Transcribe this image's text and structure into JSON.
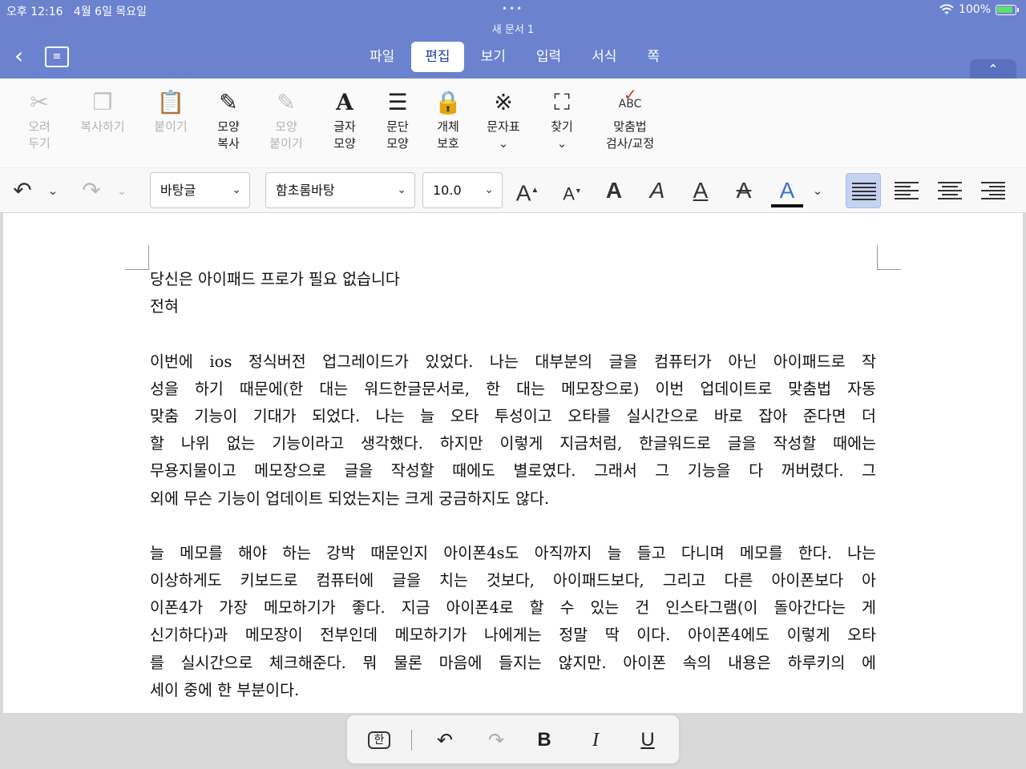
{
  "status_bar": {
    "time": "오후 12:16",
    "date": "4월 6일 목요일",
    "battery": "100%",
    "wifi_icon": "wifi-icon"
  },
  "document": {
    "title": "새 문서 1"
  },
  "menu": {
    "tabs": [
      {
        "label": "파일",
        "active": false
      },
      {
        "label": "편집",
        "active": true
      },
      {
        "label": "보기",
        "active": false
      },
      {
        "label": "입력",
        "active": false
      },
      {
        "label": "서식",
        "active": false
      },
      {
        "label": "쪽",
        "active": false
      }
    ]
  },
  "ribbon": {
    "cut": "오려\n두기",
    "copy": "복사하기",
    "paste": "붙이기",
    "format_copy": "모양\n복사",
    "format_paste": "모양\n붙이기",
    "char_shape": "글자\n모양",
    "para_shape": "문단\n모양",
    "object_protect": "개체\n보호",
    "char_map": "문자표",
    "find": "찾기",
    "spell_check": "맞춤법\n검사/교정",
    "spell_icon_text": "ABC"
  },
  "format_bar": {
    "style": "바탕글",
    "font": "함초롬바탕",
    "size": "10.0",
    "text_color": "#3b6fd6"
  },
  "body": {
    "title_lines": [
      "당신은 아이패드 프로가 필요 없습니다",
      "전혀"
    ],
    "para1": [
      "이번에 ios 정식버전 업그레이드가 있었다. 나는 대부분의 글을 컴퓨터가 아닌 아이패드로 작",
      "성을 하기 때문에(한 대는 워드한글문서로, 한 대는 메모장으로) 이번 업데이트로 맞춤법 자동",
      "맞춤 기능이 기대가 되었다. 나는 늘 오타 투성이고 오타를 실시간으로 바로 잡아 준다면 더",
      "할 나위 없는 기능이라고 생각했다. 하지만 이렇게 지금처럼, 한글워드로 글을 작성할 때에는",
      "무용지물이고 메모장으로 글을 작성할 때에도 별로였다. 그래서 그 기능을 다 꺼버렸다. 그",
      "외에 무슨 기능이 업데이트 되었는지는 크게 궁금하지도 않다."
    ],
    "para2": [
      "늘 메모를 해야 하는 강박 때문인지 아이폰4s도 아직까지 늘 들고 다니며 메모를 한다. 나는",
      "이상하게도 키보드로 컴퓨터에 글을 치는 것보다, 아이패드보다, 그리고 다른 아이폰보다 아",
      "이폰4가 가장 메모하기가 좋다. 지금 아이폰4로 할 수 있는 건 인스타그램(이 돌아간다는 게",
      "신기하다)과 메모장이 전부인데 메모하기가 나에게는 정말 딱 이다. 아이폰4에도 이렇게 오타",
      "를 실시간으로 체크해준다. 뭐 물론 마음에 들지는 않지만. 아이폰 속의 내용은 하루키의 에",
      "세이 중에 한 부분이다."
    ]
  },
  "mini_toolbar": {
    "hangul": "한",
    "bold": "B",
    "italic": "I",
    "underline": "U"
  }
}
